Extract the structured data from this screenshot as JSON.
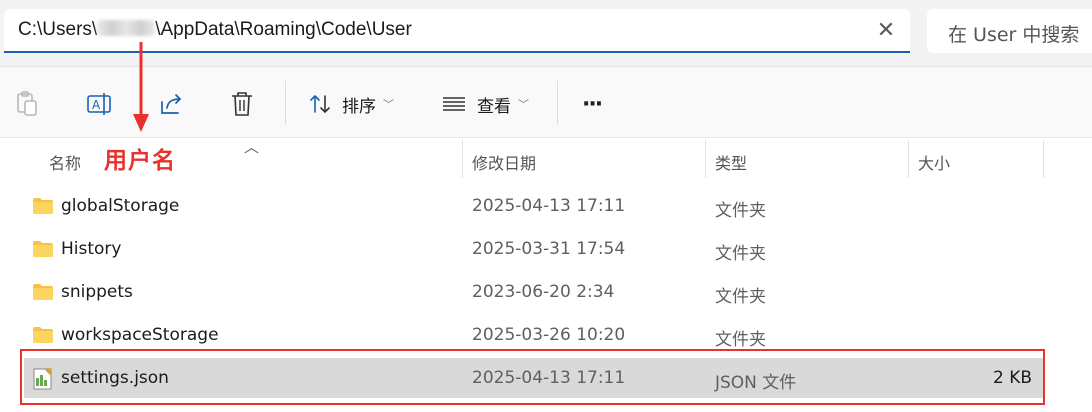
{
  "address_bar": {
    "path_prefix": "C:\\Users\\",
    "path_suffix": "\\AppData\\Roaming\\Code\\User",
    "clear_icon": "close-icon"
  },
  "search": {
    "placeholder": "在 User 中搜索"
  },
  "toolbar": {
    "sort_label": "排序",
    "view_label": "查看",
    "more_label": "···",
    "icons": [
      "paste-icon",
      "rename-icon",
      "share-icon",
      "delete-icon",
      "sort-icon",
      "view-icon"
    ]
  },
  "columns": {
    "name": "名称",
    "date": "修改日期",
    "type": "类型",
    "size": "大小"
  },
  "annotation": {
    "text": "用户名",
    "color": "#e8322b"
  },
  "files": [
    {
      "name": "globalStorage",
      "date": "2025-04-13 17:11",
      "type": "文件夹",
      "size": "",
      "icon": "folder-icon"
    },
    {
      "name": "History",
      "date": "2025-03-31 17:54",
      "type": "文件夹",
      "size": "",
      "icon": "folder-icon"
    },
    {
      "name": "snippets",
      "date": "2023-06-20 2:34",
      "type": "文件夹",
      "size": "",
      "icon": "folder-icon"
    },
    {
      "name": "workspaceStorage",
      "date": "2025-03-26 10:20",
      "type": "文件夹",
      "size": "",
      "icon": "folder-icon"
    },
    {
      "name": "settings.json",
      "date": "2025-04-13 17:11",
      "type": "JSON 文件",
      "size": "2 KB",
      "icon": "json-file-icon",
      "selected": true
    }
  ],
  "colors": {
    "accent": "#1a5fb4",
    "highlight": "#e8322b",
    "selected_row": "#d9d9d9",
    "folder": "#f6c344"
  }
}
